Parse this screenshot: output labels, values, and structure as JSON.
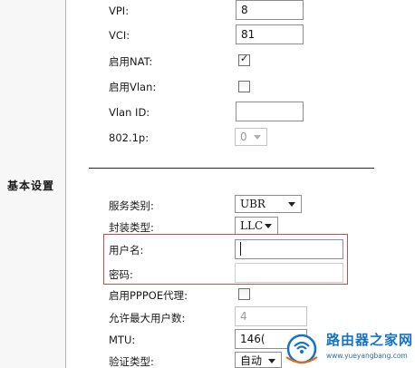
{
  "sidebar": {
    "section_title": "基本设置"
  },
  "fields": {
    "vpi": {
      "label": "VPI:",
      "value": "8"
    },
    "vci": {
      "label": "VCI:",
      "value": "81"
    },
    "nat": {
      "label": "启用NAT:",
      "checked": true
    },
    "vlan": {
      "label": "启用Vlan:",
      "checked": false
    },
    "vlan_id": {
      "label": "Vlan ID:",
      "value": ""
    },
    "priority": {
      "label": "802.1p:",
      "value": "0"
    },
    "service_type": {
      "label": "服务类别:",
      "value": "UBR"
    },
    "encap": {
      "label": "封装类型:",
      "value": "LLC"
    },
    "username": {
      "label": "用户名:",
      "value": ""
    },
    "password": {
      "label": "密码:",
      "value": ""
    },
    "pppoe_proxy": {
      "label": "启用PPPOE代理:",
      "checked": false
    },
    "max_users": {
      "label": "允许最大用户数:",
      "value": "4"
    },
    "mtu": {
      "label": "MTU:",
      "value": "146("
    },
    "auth_type": {
      "label": "验证类型:",
      "value": "自动"
    }
  },
  "watermark": {
    "title": "路由器之家网",
    "url": "www.yueyangbang.com"
  },
  "colors": {
    "highlight": "#c0504d",
    "watermark": "#1473c9"
  }
}
